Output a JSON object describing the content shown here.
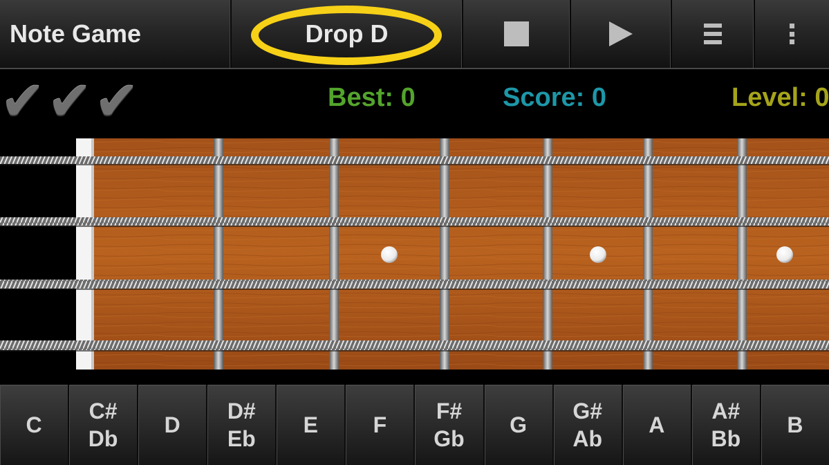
{
  "actionbar": {
    "title": "Note Game",
    "tuning": "Drop D",
    "icons": [
      "stop-icon",
      "play-icon",
      "list-icon",
      "more-icon"
    ]
  },
  "status": {
    "best": "Best: 0",
    "score": "Score: 0",
    "level": "Level: 0",
    "checkmarks": [
      "✔",
      "✔",
      "✔"
    ]
  },
  "notes": [
    {
      "top": "C",
      "bottom": ""
    },
    {
      "top": "C#",
      "bottom": "Db"
    },
    {
      "top": "D",
      "bottom": ""
    },
    {
      "top": "D#",
      "bottom": "Eb"
    },
    {
      "top": "E",
      "bottom": ""
    },
    {
      "top": "F",
      "bottom": ""
    },
    {
      "top": "F#",
      "bottom": "Gb"
    },
    {
      "top": "G",
      "bottom": ""
    },
    {
      "top": "G#",
      "bottom": "Ab"
    },
    {
      "top": "A",
      "bottom": ""
    },
    {
      "top": "A#",
      "bottom": "Bb"
    },
    {
      "top": "B",
      "bottom": ""
    }
  ],
  "colors": {
    "highlight": "#f7d117",
    "best": "#53a42c",
    "score": "#1d97a8",
    "level": "#a5a41a",
    "wood": "#b05a1c"
  }
}
